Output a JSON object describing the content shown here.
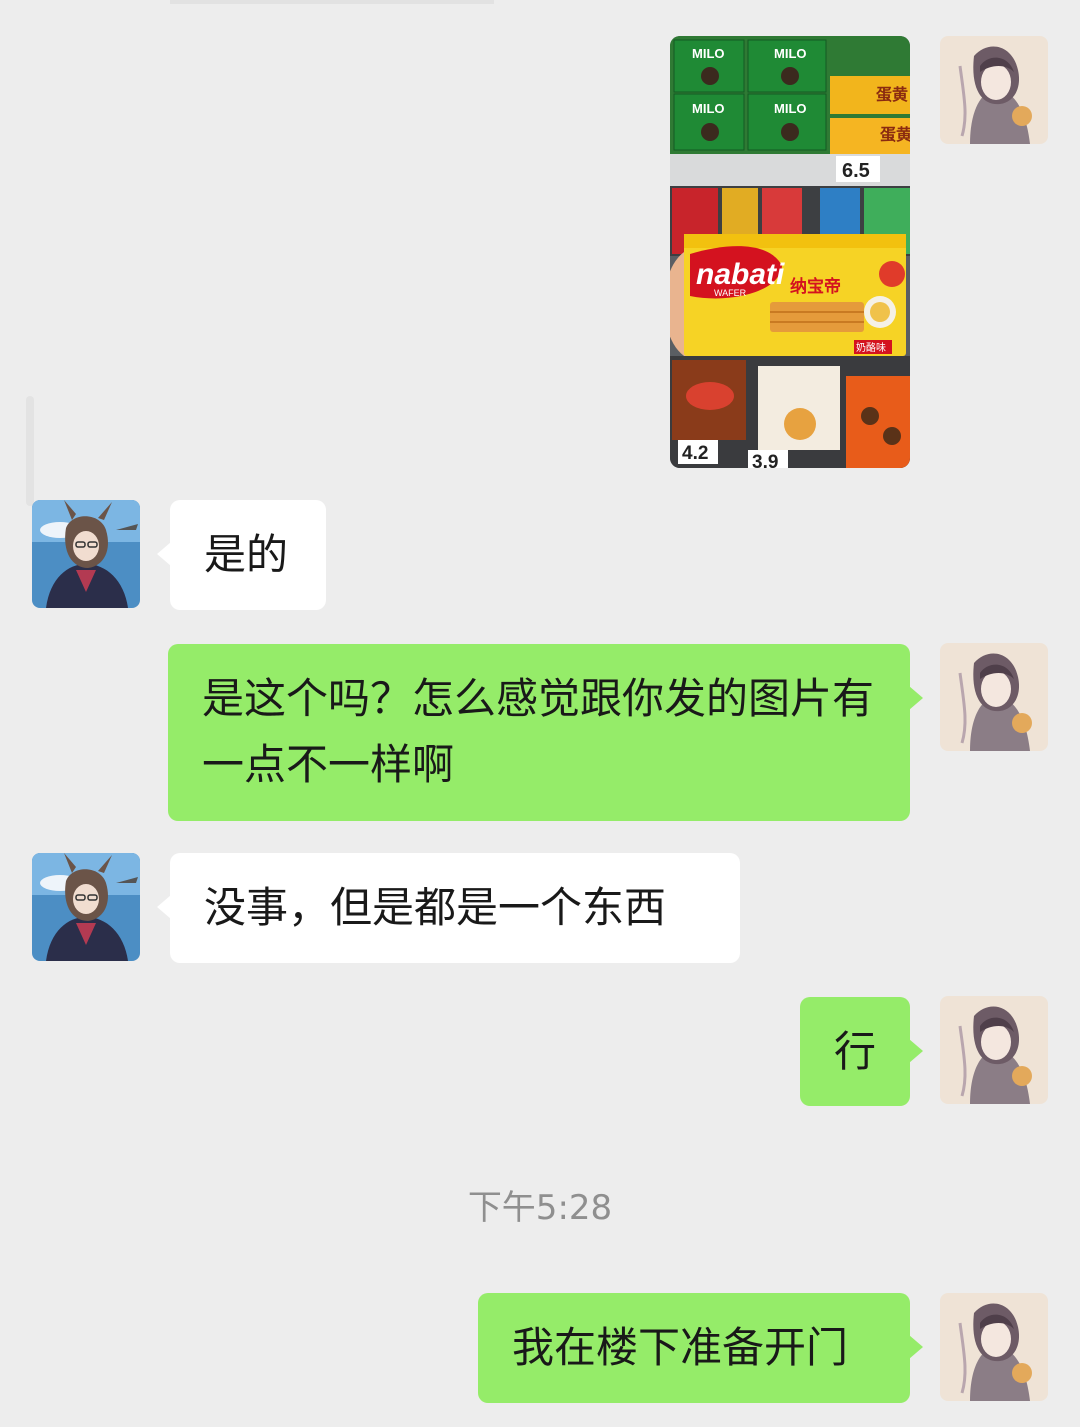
{
  "messages": [
    {
      "sender": "other",
      "text": "是的"
    },
    {
      "sender": "self",
      "text": "是这个吗？怎么感觉跟你发的图片有一点不一样啊"
    },
    {
      "sender": "other",
      "text": "没事，但是都是一个东西"
    },
    {
      "sender": "self",
      "text": "行"
    },
    {
      "sender": "self",
      "text": "我在楼下准备开门"
    }
  ],
  "timestamp": "下午5:28",
  "photo": {
    "shelf_labels": [
      "MILO",
      "MILO",
      "MILO",
      "MILO",
      "蛋黄",
      "蛋黄"
    ],
    "brand": "nabati",
    "brand_sub": "WAFER",
    "product_name": "纳宝帝",
    "flavor_tag": "奶酪味",
    "prices": [
      "6.5",
      "4.2",
      "3.9"
    ]
  },
  "colors": {
    "background": "#ededed",
    "self_bubble": "#95ec69",
    "other_bubble": "#ffffff",
    "timestamp": "#8f8f8f"
  }
}
